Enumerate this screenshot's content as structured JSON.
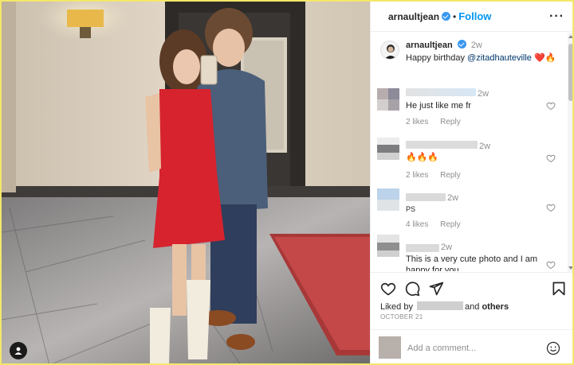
{
  "post": {
    "username": "arnaultjean",
    "separator": "•",
    "follow_label": "Follow",
    "more_label": "···"
  },
  "caption": {
    "username": "arnaultjean",
    "time": "2w",
    "text_before": "Happy birthday ",
    "mention": "@zitadhauteville",
    "emojis": "❤️🔥"
  },
  "comments": [
    {
      "time": "2w",
      "text": "He just like me fr",
      "likes": "2 likes",
      "reply": "Reply"
    },
    {
      "time": "2w",
      "text": "🔥🔥🔥",
      "likes": "2 likes",
      "reply": "Reply"
    },
    {
      "time": "2w",
      "text": "PS",
      "likes": "4 likes",
      "reply": "Reply"
    },
    {
      "time": "2w",
      "text": "This is a very cute photo and I am happy for you",
      "likes": "",
      "reply": ""
    }
  ],
  "liked_by": {
    "prefix": "Liked by ",
    "middle": "and ",
    "others": "others"
  },
  "date": "OCTOBER 21",
  "add_comment": {
    "placeholder": "Add a comment..."
  },
  "icons": {
    "like": "heart-icon",
    "comment": "comment-icon",
    "share": "share-icon",
    "save": "bookmark-icon",
    "emoji": "emoji-icon",
    "verified": "verified-badge-icon",
    "tag": "tag-person-icon"
  },
  "colors": {
    "accent": "#0095f6",
    "verified": "#3897f0",
    "heart": "#ed4956"
  }
}
